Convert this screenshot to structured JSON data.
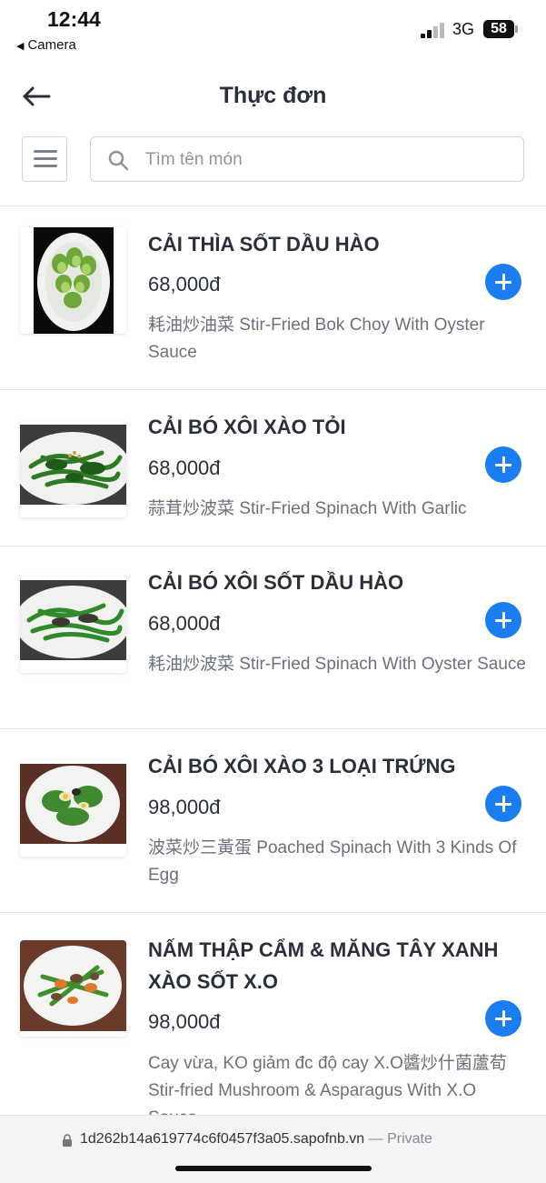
{
  "status_bar": {
    "time": "12:44",
    "back_app": "Camera",
    "network": "3G",
    "battery": "58"
  },
  "header": {
    "title": "Thực đơn"
  },
  "search": {
    "placeholder": "Tìm tên món"
  },
  "items": [
    {
      "name": "CẢI THÌA SỐT DẦU HÀO",
      "price": "68,000đ",
      "description": "耗油炒油菜 Stir-Fried Bok Choy With Oyster Sauce"
    },
    {
      "name": "CẢI BÓ XÔI XÀO TỎI",
      "price": "68,000đ",
      "description": "蒜茸炒波菜 Stir-Fried Spinach With Garlic"
    },
    {
      "name": "CẢI BÓ XÔI SỐT DẦU HÀO",
      "price": "68,000đ",
      "description": "耗油炒波菜 Stir-Fried Spinach With Oyster Sauce"
    },
    {
      "name": "CẢI BÓ XÔI XÀO 3 LOẠI TRỨNG",
      "price": "98,000đ",
      "description": "波菜炒三黃蛋 Poached Spinach With 3 Kinds Of Egg"
    },
    {
      "name": "NẤM THẬP CẨM & MĂNG TÂY XANH XÀO SỐT X.O",
      "price": "98,000đ",
      "description": "Cay vừa, KO giảm đc độ cay X.O醬炒什菌蘆荀 Stir-fried Mushroom & Asparagus With X.O Sauce"
    }
  ],
  "browser": {
    "url": "1d262b14a619774c6f0457f3a05.sapofnb.vn",
    "privacy": "— Private"
  },
  "colors": {
    "accent": "#1a7ef0",
    "text": "#2a2f3a",
    "muted": "#6b717c",
    "divider": "#e3e5e9"
  }
}
